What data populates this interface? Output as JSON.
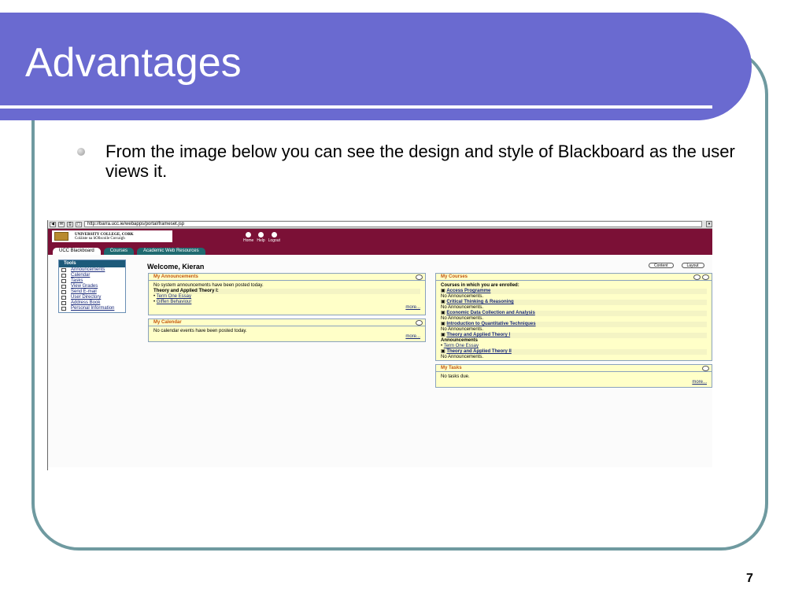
{
  "slide": {
    "title": "Advantages",
    "bullet": "From the image below you can see the design and style of Blackboard as the user views it.",
    "page_number": "7",
    "colors": {
      "header": "#6a6ad0",
      "frame": "#6f9aa0",
      "bb_header": "#7b1036"
    }
  },
  "screenshot": {
    "browser": {
      "url": "http://barra.ucc.ie/webapps/portal/frameset.jsp"
    },
    "header": {
      "logo_line1": "UNIVERSITY COLLEGE, CORK",
      "logo_line2": "Coláiste na hOllscoile Corcaigh",
      "links": [
        "Home",
        "Help",
        "Logout"
      ]
    },
    "tabs": [
      "UCC Blackboard",
      "Courses",
      "Academic Web Resources"
    ],
    "welcome": "Welcome, Kieran",
    "buttons": {
      "content": "Content",
      "layout": "Layout"
    },
    "tools": {
      "title": "Tools",
      "items": [
        "Announcements",
        "Calendar",
        "Tasks",
        "View Grades",
        "Send E-mail",
        "User Directory",
        "Address Book",
        "Personal Information"
      ]
    },
    "announcements": {
      "title": "My Announcements",
      "line1": "No system announcements have been posted today.",
      "course": "Theory and Applied Theory I:",
      "items": [
        "Term One Essay",
        "Giffen Behaviour"
      ],
      "more": "more..."
    },
    "calendar": {
      "title": "My Calendar",
      "line1": "No calendar events have been posted today.",
      "more": "more..."
    },
    "courses": {
      "title": "My Courses",
      "heading": "Courses in which you are enrolled:",
      "list": [
        {
          "name": "Access Programme",
          "note": "No Announcements."
        },
        {
          "name": "Critical Thinking & Reasoning",
          "note": "No Announcements."
        },
        {
          "name": "Economic Data Collection and Analysis",
          "note": "No Announcements."
        },
        {
          "name": "Introduction to Quantitative Techniques",
          "note": "No Announcements."
        },
        {
          "name": "Theory and Applied Theory I",
          "note": "Announcements"
        }
      ],
      "ann_item": "Term One Essay",
      "last_course": "Theory and Applied Theory II",
      "last_note": "No Announcements."
    },
    "tasks": {
      "title": "My Tasks",
      "line1": "No tasks due.",
      "more": "more..."
    }
  }
}
